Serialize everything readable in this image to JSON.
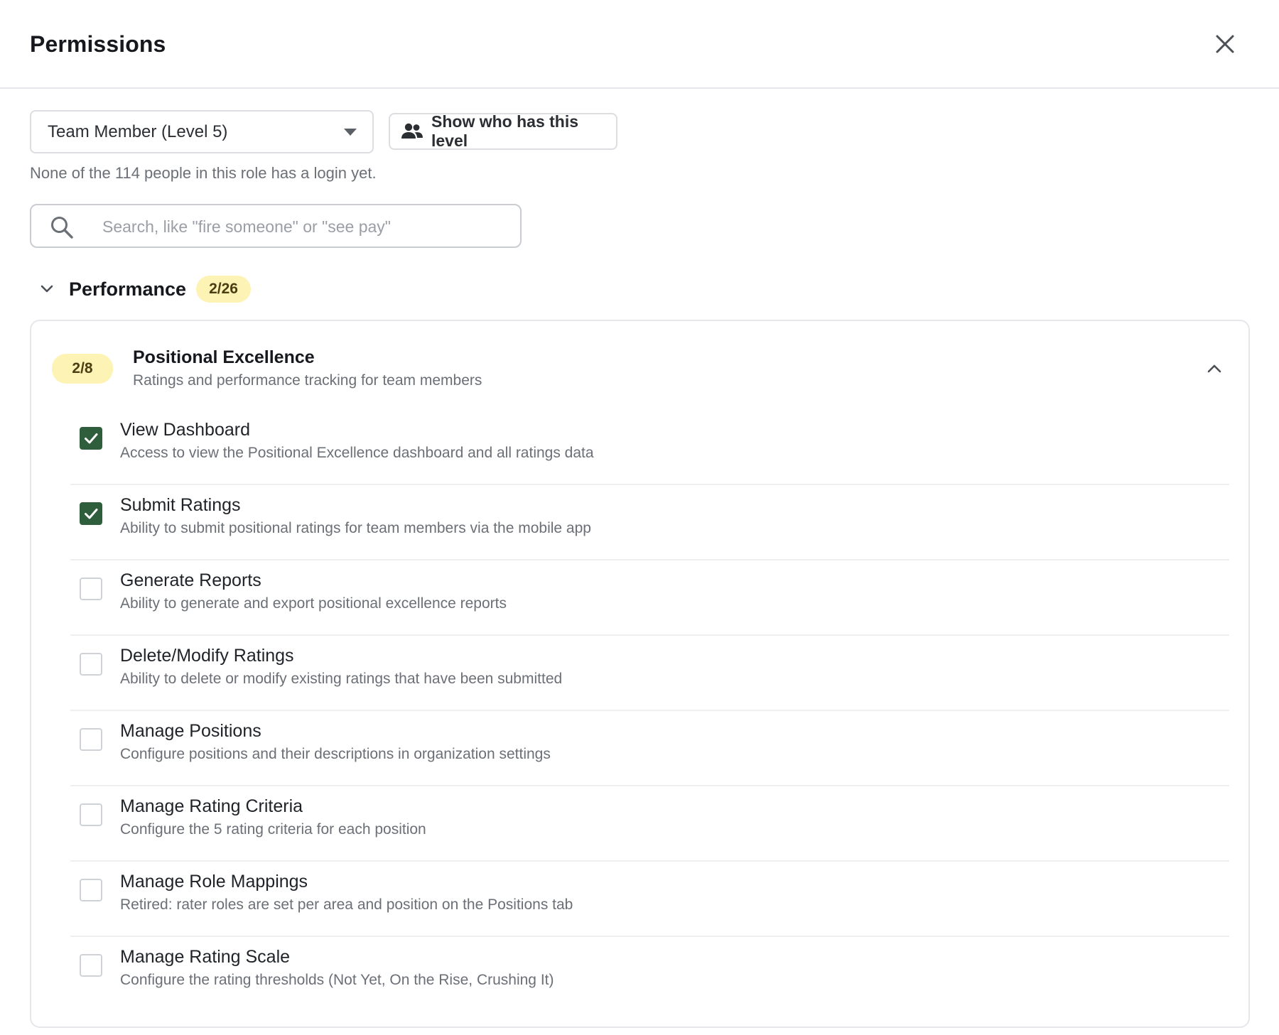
{
  "dialog": {
    "title": "Permissions",
    "close_icon": "close-icon"
  },
  "role": {
    "selected": "Team Member (Level 5)",
    "show_button_label": "Show who has this level",
    "note": "None of the 114 people in this role has a login yet."
  },
  "search": {
    "placeholder": "Search, like \"fire someone\" or \"see pay\"",
    "value": ""
  },
  "section": {
    "name": "Performance",
    "count": "2/26",
    "expanded": true
  },
  "group": {
    "name": "Positional Excellence",
    "description": "Ratings and performance tracking for team members",
    "count": "2/8",
    "expanded": true
  },
  "permissions": [
    {
      "name": "View Dashboard",
      "description": "Access to view the Positional Excellence dashboard and all ratings data",
      "checked": true
    },
    {
      "name": "Submit Ratings",
      "description": "Ability to submit positional ratings for team members via the mobile app",
      "checked": true
    },
    {
      "name": "Generate Reports",
      "description": "Ability to generate and export positional excellence reports",
      "checked": false
    },
    {
      "name": "Delete/Modify Ratings",
      "description": "Ability to delete or modify existing ratings that have been submitted",
      "checked": false
    },
    {
      "name": "Manage Positions",
      "description": "Configure positions and their descriptions in organization settings",
      "checked": false
    },
    {
      "name": "Manage Rating Criteria",
      "description": "Configure the 5 rating criteria for each position",
      "checked": false
    },
    {
      "name": "Manage Role Mappings",
      "description": "Retired: rater roles are set per area and position on the Positions tab",
      "checked": false
    },
    {
      "name": "Manage Rating Scale",
      "description": "Configure the rating thresholds (Not Yet, On the Rise, Crushing It)",
      "checked": false
    }
  ],
  "colors": {
    "badge_bg": "#fdf3b4",
    "checked": "#2f5e3c",
    "muted_text": "#6b6f76"
  }
}
